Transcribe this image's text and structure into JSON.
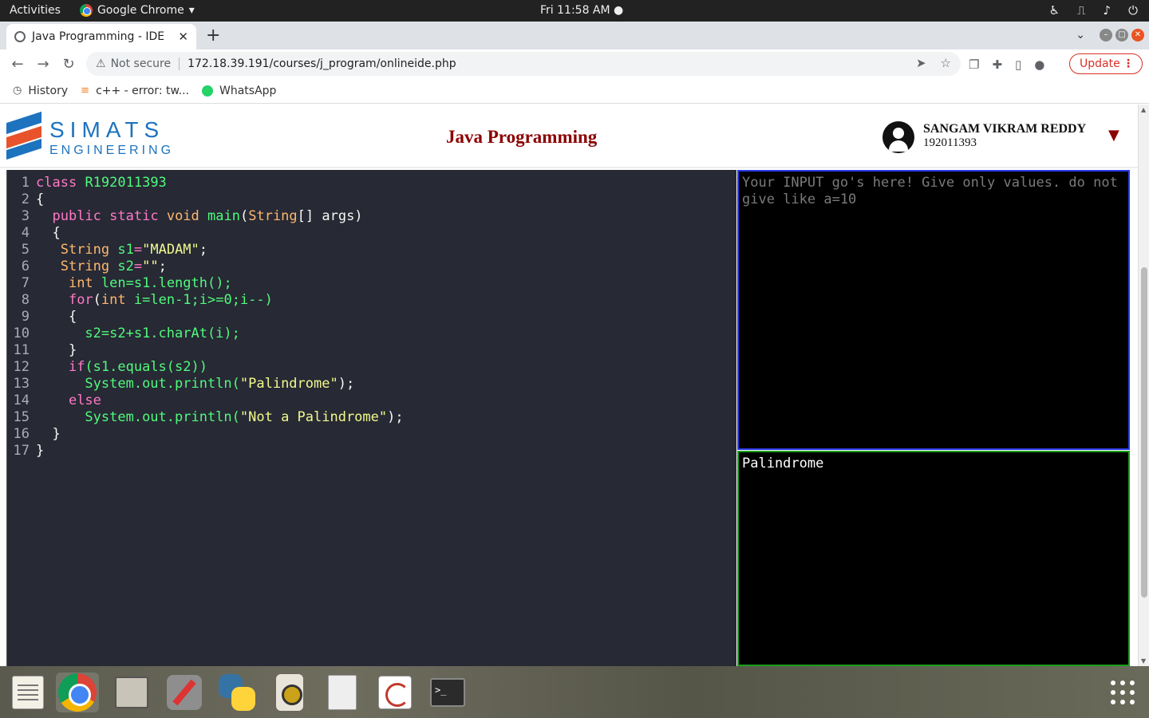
{
  "system": {
    "activities": "Activities",
    "app_name": "Google Chrome",
    "app_caret": "▾",
    "clock": "Fri 11:58 AM ●",
    "tray_icons": [
      "accessibility-icon",
      "network-icon",
      "volume-icon",
      "power-icon"
    ]
  },
  "browser": {
    "tab_title": "Java Programming - IDE",
    "tab_close": "✕",
    "new_tab": "+",
    "security_label": "Not secure",
    "url": "172.18.39.191/courses/j_program/onlineide.php",
    "update_label": "Update",
    "update_menu": "⋮",
    "bookmarks": [
      {
        "label": "History",
        "icon": "history-icon"
      },
      {
        "label": "c++ - error: tw...",
        "icon": "stackoverflow-icon"
      },
      {
        "label": "WhatsApp",
        "icon": "whatsapp-icon"
      }
    ]
  },
  "page": {
    "logo_top": "SIMATS",
    "logo_bottom": "ENGINEERING",
    "title": "Java Programming",
    "user_name": "SANGAM VIKRAM REDDY",
    "user_id": "192011393",
    "user_menu": "▼"
  },
  "editor": {
    "lines": [
      {
        "n": "1"
      },
      {
        "n": "2"
      },
      {
        "n": "3"
      },
      {
        "n": "4"
      },
      {
        "n": "5"
      },
      {
        "n": "6"
      },
      {
        "n": "7"
      },
      {
        "n": "8"
      },
      {
        "n": "9"
      },
      {
        "n": "10"
      },
      {
        "n": "11"
      },
      {
        "n": "12"
      },
      {
        "n": "13"
      },
      {
        "n": "14"
      },
      {
        "n": "15"
      },
      {
        "n": "16"
      },
      {
        "n": "17"
      }
    ],
    "code": {
      "l1_kw": "class",
      "l1_name": "R192011393",
      "l2": "{",
      "l3_pub": "public",
      "l3_static": "static",
      "l3_void": "void",
      "l3_main": "main",
      "l3_type": "String",
      "l3_rest": "[] args)",
      "l4": "{",
      "l5_type": "String",
      "l5_var": "s1",
      "l5_str": "\"MADAM\"",
      "l6_type": "String",
      "l6_var": "s2",
      "l6_str": "\"\"",
      "l7_type": "int",
      "l7_var": "len",
      "l7_rest": "=s1.length();",
      "l8_for": "for",
      "l8_type": "int",
      "l8_rest": "i=len-1;i>=0;i--)",
      "l9": "{",
      "l10": "s2=s2+s1.charAt(i);",
      "l11": "}",
      "l12_if": "if",
      "l12_rest": "(s1.equals(s2))",
      "l13_call": "System.out.println(",
      "l13_str": "\"Palindrome\"",
      "l13_end": ");",
      "l14": "else",
      "l15_call": "System.out.println(",
      "l15_str": "\"Not a Palindrome\"",
      "l15_end": ");",
      "l16": "}",
      "l17": "}"
    }
  },
  "io": {
    "input_placeholder": "Your INPUT go's here! Give only values. do not give like a=10",
    "output": "Palindrome"
  },
  "dock": {
    "apps": [
      "text-editor-icon",
      "chrome-icon",
      "files-icon",
      "tools-icon",
      "python-icon",
      "audio-player-icon",
      "document-icon",
      "pdf-viewer-icon",
      "terminal-icon"
    ]
  },
  "colors": {
    "page_title": "#8b0000",
    "input_border": "#2a3be8",
    "output_border": "#1a9e1a",
    "editor_bg": "#272935",
    "update": "#d93025"
  }
}
